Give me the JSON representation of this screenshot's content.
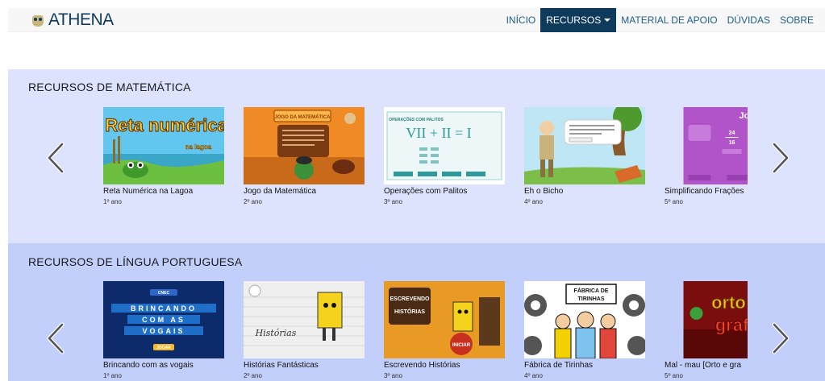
{
  "brand": {
    "name": "ATHENA"
  },
  "nav": {
    "items": [
      "INÍCIO",
      "RECURSOS",
      "MATERIAL DE APOIO",
      "DÚVIDAS",
      "SOBRE"
    ]
  },
  "sections": {
    "mat": {
      "title": "RECURSOS DE MATEMÁTICA",
      "cards": [
        {
          "title": "Reta Numérica na Lagoa",
          "grade": "1º ano",
          "thumb_text": "Reta numérica",
          "thumb_sub": "na lagoa"
        },
        {
          "title": "Jogo da Matemática",
          "grade": "2º ano",
          "thumb_text": "JOGO DA MATEMÁTICA"
        },
        {
          "title": "Operações com Palitos",
          "grade": "3º ano",
          "thumb_text": "OPERAÇÕES COM PALITOS",
          "thumb_eq": "VII + II = I"
        },
        {
          "title": "Eh o Bicho",
          "grade": "4º ano"
        },
        {
          "title": "Simplificando Frações",
          "grade": "5º ano",
          "thumb_text": "Jogar",
          "thumb_num": "24",
          "thumb_den": "16"
        }
      ]
    },
    "port": {
      "title": "RECURSOS DE LÍNGUA PORTUGUESA",
      "cards": [
        {
          "title": "Brincando com as vogais",
          "grade": "1º ano",
          "thumb_logo": "CNEC",
          "thumb_btn": "JOGAR",
          "thumb_words": [
            "BRINCANDO",
            "COM AS",
            "VOGAIS"
          ]
        },
        {
          "title": "Histórias Fantásticas",
          "grade": "2º ano",
          "thumb_text": "Histórias"
        },
        {
          "title": "Escrevendo Histórias",
          "grade": "3º ano",
          "thumb_text": "ESCREVENDO",
          "thumb_sub": "HISTÓRIAS",
          "thumb_btn": "INICIAR"
        },
        {
          "title": "Fábrica de Tirinhas",
          "grade": "4º ano",
          "thumb_text": "FÁBRICA DE",
          "thumb_sub": "TIRINHAS"
        },
        {
          "title": "Mal - mau [Orto e gra",
          "grade": "5º ano",
          "thumb_text": "orto",
          "thumb_sub": "graf"
        }
      ]
    }
  },
  "colors": {
    "nav_active": "#0e3a5c",
    "section_mat": "#dde3fd",
    "section_port": "#c2cffb"
  }
}
